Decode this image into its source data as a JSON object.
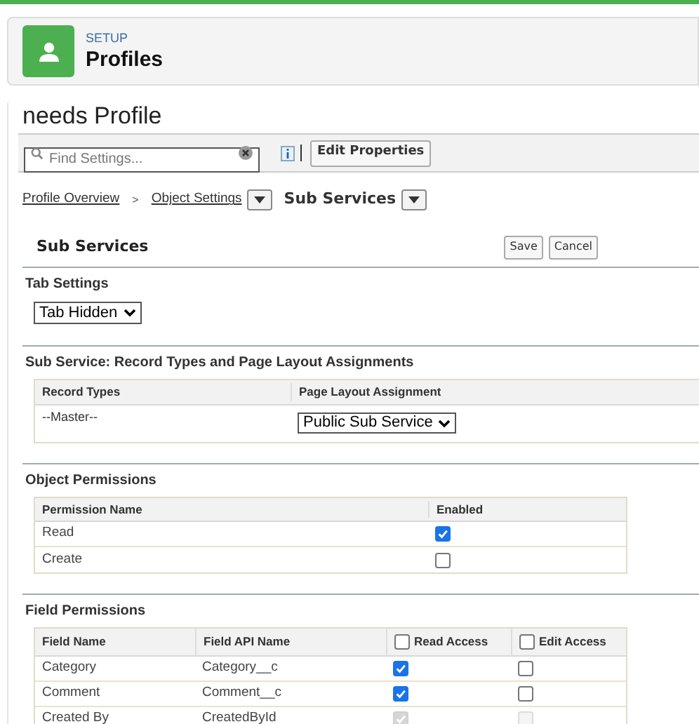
{
  "header": {
    "eyebrow": "SETUP",
    "title": "Profiles"
  },
  "profile_name": "needs Profile",
  "search": {
    "placeholder": "Find Settings..."
  },
  "toolbar_button": "Edit Properties",
  "breadcrumb": [
    {
      "label": "Profile Overview",
      "kind": "link"
    },
    {
      "label": ">",
      "kind": "separator"
    },
    {
      "label": "Object Settings",
      "kind": "link-menu"
    },
    {
      "label": "Sub Services",
      "kind": "current-menu"
    }
  ],
  "object": {
    "title": "Sub Services",
    "buttons": [
      "Save",
      "Cancel"
    ]
  },
  "tab_settings": {
    "title": "Tab Settings",
    "value": "Tab Hidden"
  },
  "record_types": {
    "title": "Sub Service: Record Types and Page Layout Assignments",
    "columns": [
      "Record Types",
      "Page Layout Assignment"
    ],
    "rows": [
      {
        "record_type": "--Master--",
        "layout": "Public Sub Service"
      }
    ]
  },
  "object_permissions": {
    "title": "Object Permissions",
    "columns": [
      "Permission Name",
      "Enabled"
    ],
    "rows": [
      {
        "name": "Read",
        "checked": true
      },
      {
        "name": "Create",
        "checked": false
      }
    ]
  },
  "field_permissions": {
    "title": "Field Permissions",
    "columns": [
      {
        "label": "Field Name",
        "kind": "text"
      },
      {
        "label": "Field API Name",
        "kind": "text"
      },
      {
        "label": "Read Access",
        "kind": "checkbox",
        "checked": false
      },
      {
        "label": "Edit Access",
        "kind": "checkbox",
        "checked": false
      }
    ],
    "rows": [
      {
        "name": "Category",
        "api_name": "Category__c",
        "read": {
          "checked": true,
          "disabled": false
        },
        "edit": {
          "checked": false,
          "disabled": false
        }
      },
      {
        "name": "Comment",
        "api_name": "Comment__c",
        "read": {
          "checked": true,
          "disabled": false
        },
        "edit": {
          "checked": false,
          "disabled": false
        }
      },
      {
        "name": "Created By",
        "api_name": "CreatedById",
        "read": {
          "checked": true,
          "disabled": true
        },
        "edit": {
          "checked": false,
          "disabled": true
        }
      }
    ]
  }
}
